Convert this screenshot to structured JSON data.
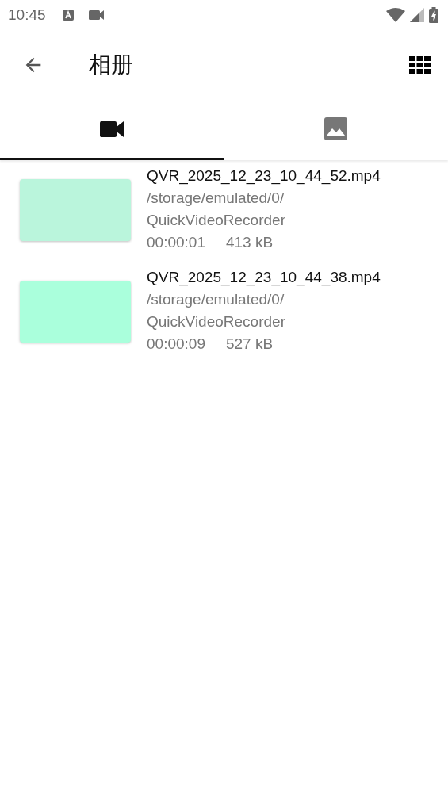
{
  "status_bar": {
    "time": "10:45"
  },
  "app_bar": {
    "title": "相册"
  },
  "tabs": [
    {
      "kind": "video",
      "selected": true
    },
    {
      "kind": "image",
      "selected": false
    }
  ],
  "videos": [
    {
      "name": "QVR_2025_12_23_10_44_52.mp4",
      "path_lines": [
        "/storage/emulated/0/",
        "QuickVideoRecorder"
      ],
      "duration": "00:00:01",
      "size": "413 kB",
      "color": "#baf5dc"
    },
    {
      "name": "QVR_2025_12_23_10_44_38.mp4",
      "path_lines": [
        "/storage/emulated/0/",
        "QuickVideoRecorder"
      ],
      "duration": "00:00:09",
      "size": "527 kB",
      "color": "#aaffdc"
    }
  ]
}
